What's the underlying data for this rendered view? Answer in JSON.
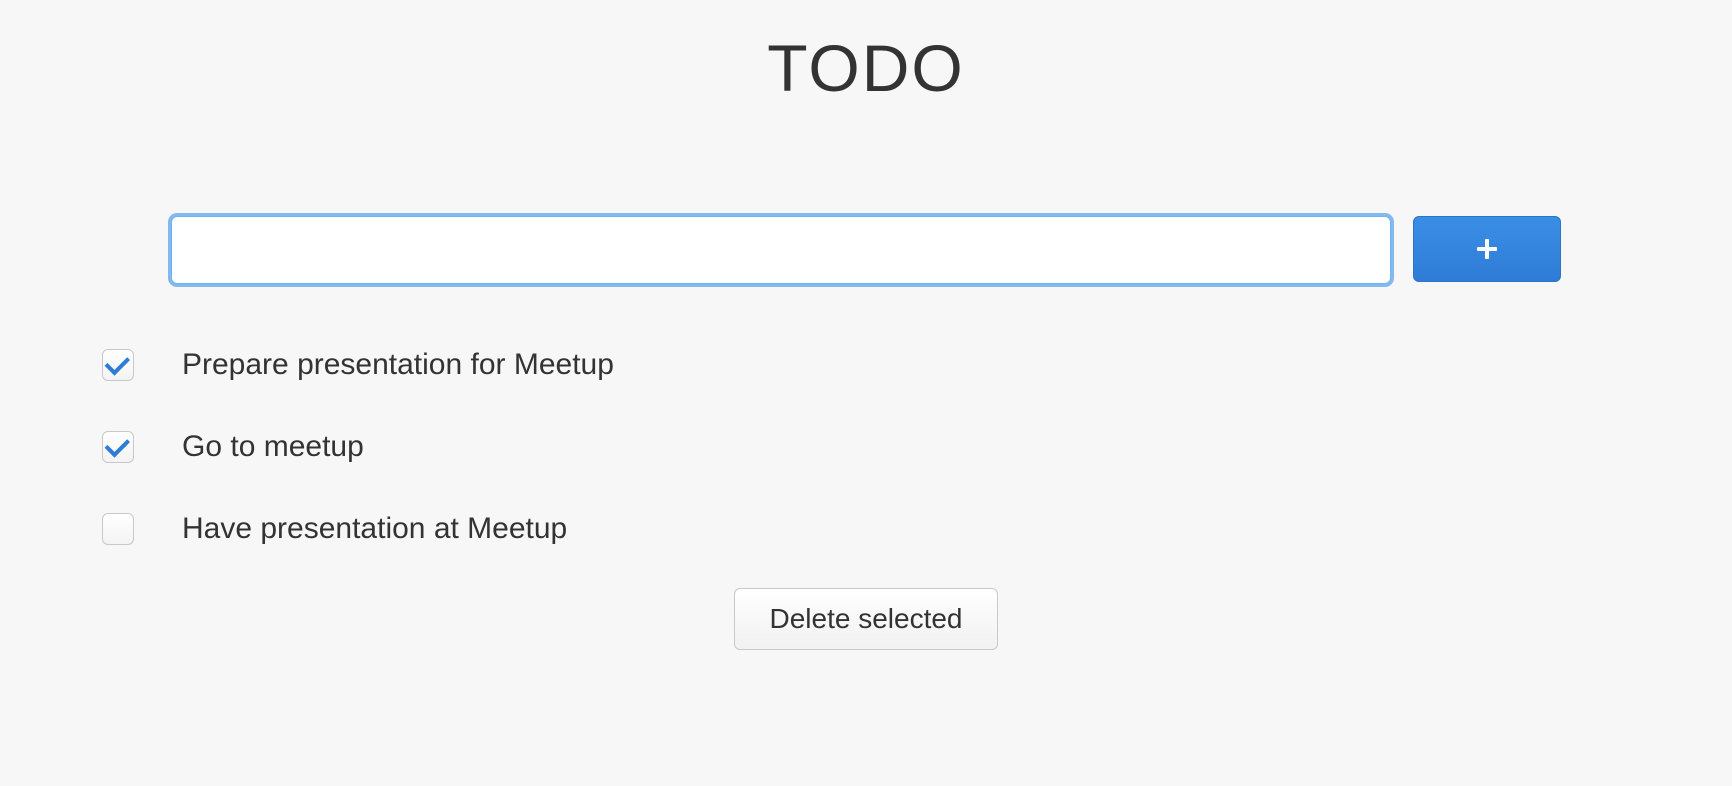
{
  "header": {
    "title": "TODO"
  },
  "input": {
    "value": "",
    "placeholder": ""
  },
  "buttons": {
    "add_icon": "plus-icon",
    "delete_label": "Delete selected"
  },
  "todos": [
    {
      "label": "Prepare presentation for Meetup",
      "checked": true
    },
    {
      "label": "Go to meetup",
      "checked": true
    },
    {
      "label": "Have presentation at Meetup",
      "checked": false
    }
  ]
}
